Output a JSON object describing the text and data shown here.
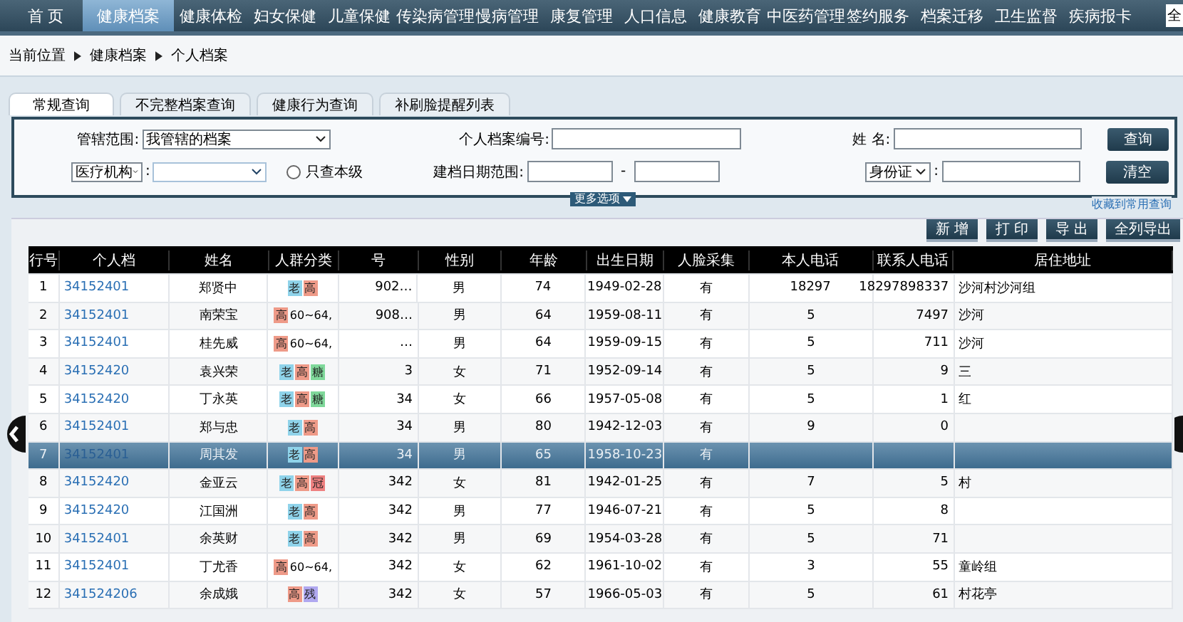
{
  "nav": {
    "items": [
      {
        "label": "首 页",
        "selected": false
      },
      {
        "label": "健康档案",
        "selected": true
      },
      {
        "label": "健康体检",
        "selected": false
      },
      {
        "label": "妇女保健",
        "selected": false
      },
      {
        "label": "儿童保健",
        "selected": false
      },
      {
        "label": "传染病管理",
        "selected": false
      },
      {
        "label": "慢病管理",
        "selected": false
      },
      {
        "label": "康复管理",
        "selected": false
      },
      {
        "label": "人口信息",
        "selected": false
      },
      {
        "label": "健康教育",
        "selected": false
      },
      {
        "label": "中医药管理",
        "selected": false
      },
      {
        "label": "签约服务",
        "selected": false
      },
      {
        "label": "档案迁移",
        "selected": false
      },
      {
        "label": "卫生监督",
        "selected": false
      },
      {
        "label": "疾病报卡",
        "selected": false
      }
    ],
    "all_button": "全"
  },
  "breadcrumb": [
    "当前位置",
    "健康档案",
    "个人档案"
  ],
  "tabs": [
    {
      "label": "常规查询",
      "selected": true
    },
    {
      "label": "不完整档案查询",
      "selected": false
    },
    {
      "label": "健康行为查询",
      "selected": false
    },
    {
      "label": "补刷脸提醒列表",
      "selected": false
    }
  ],
  "search": {
    "scope_label": "管辖范围:",
    "scope_value": "我管辖的档案",
    "id_label": "个人档案编号:",
    "name_label": "姓 名:",
    "org_select": "医疗机构",
    "org_colon": ":",
    "only_level": {
      "label": "只查本级",
      "checked": false
    },
    "date_label": "建档日期范围:",
    "date_sep": "-",
    "idtype_select": "身份证",
    "idtype_colon": ":",
    "query_button": "查询",
    "clear_button": "清空",
    "save_link": "收藏到常用查询",
    "more_button": "更多选项"
  },
  "actions": [
    "新 增",
    "打 印",
    "导 出",
    "全列导出"
  ],
  "table": {
    "columns": [
      "行号",
      "个人档",
      "姓名",
      "人群分类",
      "号",
      "性别",
      "年龄",
      "出生日期",
      "人脸采集",
      "本人电话",
      "联系人电话",
      "居住地址"
    ],
    "rows": [
      {
        "no": "1",
        "id": "34152401",
        "name": "郑贤中",
        "tags": [
          {
            "text": "老",
            "color": "#8fd3ea"
          },
          {
            "text": "高",
            "color": "#ee9a88"
          }
        ],
        "column_5": "902…",
        "sex": "男",
        "age": "74",
        "birth": "1949-02-28",
        "face": "有",
        "phone": "18297",
        "contact": "18297898337",
        "address": "沙河村沙河组",
        "selected": false
      },
      {
        "no": "2",
        "id": "34152401",
        "name": "南荣宝",
        "tags": [
          {
            "text": "高",
            "color": "#ee9a88"
          }
        ],
        "extra": "60~64,",
        "column_5": "908…",
        "sex": "男",
        "age": "64",
        "birth": "1959-08-11",
        "face": "有",
        "phone": "5",
        "contact": "7497",
        "address": "沙河",
        "selected": false
      },
      {
        "no": "3",
        "id": "34152401",
        "name": "桂先威",
        "tags": [
          {
            "text": "高",
            "color": "#ee9a88"
          }
        ],
        "extra": "60~64,",
        "column_5": "…",
        "sex": "男",
        "age": "64",
        "birth": "1959-09-15",
        "face": "有",
        "phone": "5",
        "contact": "711",
        "address": "沙河",
        "selected": false
      },
      {
        "no": "4",
        "id": "34152420",
        "name": "袁兴荣",
        "tags": [
          {
            "text": "老",
            "color": "#8fd3ea"
          },
          {
            "text": "高",
            "color": "#ee9a88"
          },
          {
            "text": "糖",
            "color": "#7fd89a"
          }
        ],
        "column_5": "3",
        "sex": "女",
        "age": "71",
        "birth": "1952-09-14",
        "face": "有",
        "phone": "5",
        "contact": "9",
        "address": "三",
        "selected": false
      },
      {
        "no": "5",
        "id": "34152420",
        "name": "丁永英",
        "tags": [
          {
            "text": "老",
            "color": "#8fd3ea"
          },
          {
            "text": "高",
            "color": "#ee9a88"
          },
          {
            "text": "糖",
            "color": "#7fd89a"
          }
        ],
        "column_5": "34",
        "sex": "女",
        "age": "66",
        "birth": "1957-05-08",
        "face": "有",
        "phone": "5",
        "contact": "1",
        "address": "红",
        "selected": false
      },
      {
        "no": "6",
        "id": "34152401",
        "name": "郑与忠",
        "tags": [
          {
            "text": "老",
            "color": "#8fd3ea"
          },
          {
            "text": "高",
            "color": "#ee9a88"
          }
        ],
        "column_5": "34",
        "sex": "男",
        "age": "80",
        "birth": "1942-12-03",
        "face": "有",
        "phone": "9",
        "contact": "0",
        "selected": false
      },
      {
        "no": "7",
        "id": "34152401",
        "name": "周其发",
        "tags": [
          {
            "text": "老",
            "color": "#8fd3ea"
          },
          {
            "text": "高",
            "color": "#ee9a88"
          }
        ],
        "column_5": "34",
        "sex": "男",
        "age": "65",
        "birth": "1958-10-23",
        "face": "有",
        "selected": true
      },
      {
        "no": "8",
        "id": "34152420",
        "name": "金亚云",
        "tags": [
          {
            "text": "老",
            "color": "#8fd3ea"
          },
          {
            "text": "高",
            "color": "#ee9a88"
          },
          {
            "text": "冠",
            "color": "#ee8080"
          }
        ],
        "column_5": "342",
        "sex": "女",
        "age": "81",
        "birth": "1942-01-25",
        "face": "有",
        "phone": "7",
        "contact": "5",
        "address": "村",
        "selected": false
      },
      {
        "no": "9",
        "id": "34152420",
        "name": "江国洲",
        "tags": [
          {
            "text": "老",
            "color": "#8fd3ea"
          },
          {
            "text": "高",
            "color": "#ee9a88"
          }
        ],
        "column_5": "342",
        "sex": "男",
        "age": "77",
        "birth": "1946-07-21",
        "face": "有",
        "phone": "5",
        "contact": "8",
        "selected": false
      },
      {
        "no": "10",
        "id": "34152401",
        "name": "余英财",
        "tags": [
          {
            "text": "老",
            "color": "#8fd3ea"
          },
          {
            "text": "高",
            "color": "#ee9a88"
          }
        ],
        "column_5": "342",
        "sex": "男",
        "age": "69",
        "birth": "1954-03-28",
        "face": "有",
        "phone": "5",
        "contact": "71",
        "selected": false
      },
      {
        "no": "11",
        "id": "34152401",
        "name": "丁尤香",
        "tags": [
          {
            "text": "高",
            "color": "#ee9a88"
          }
        ],
        "extra": "60~64,",
        "column_5": "342",
        "sex": "女",
        "age": "62",
        "birth": "1961-10-02",
        "face": "有",
        "phone": "3",
        "contact": "55",
        "address": "童岭组",
        "selected": false
      },
      {
        "no": "12",
        "id": "341524206",
        "name": "余成娥",
        "tags": [
          {
            "text": "高",
            "color": "#ee9a88"
          },
          {
            "text": "残",
            "color": "#b0a8f0"
          }
        ],
        "column_5": "342",
        "sex": "女",
        "age": "57",
        "birth": "1966-05-03",
        "face": "有",
        "phone": "5",
        "contact": "61",
        "address": "村花亭",
        "selected": false
      }
    ]
  }
}
